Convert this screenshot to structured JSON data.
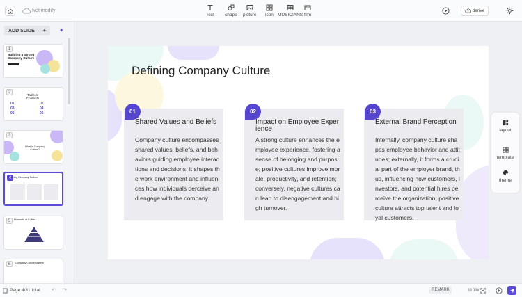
{
  "topbar": {
    "status": "Not modify",
    "tools": [
      {
        "label": "Text",
        "icon": "text-icon"
      },
      {
        "label": "shape",
        "icon": "shape-icon"
      },
      {
        "label": "picture",
        "icon": "picture-icon"
      },
      {
        "label": "icon",
        "icon": "icon-grid-icon"
      },
      {
        "label": "MUSICIANS",
        "icon": "table-icon"
      },
      {
        "label": "film",
        "icon": "film-icon"
      }
    ],
    "derive_label": "derive"
  },
  "sidebar": {
    "add_slide_label": "ADD SLIDE",
    "thumbnails": [
      {
        "num": "1",
        "title": "Building a Strong Company Culture"
      },
      {
        "num": "2",
        "title": "Table of Contents"
      },
      {
        "num": "3",
        "title": "What is Company Culture?"
      },
      {
        "num": "4",
        "title": "Defining Company Culture"
      },
      {
        "num": "5",
        "title": "Elements of Culture"
      },
      {
        "num": "6",
        "title": "Company Culture Matters"
      }
    ]
  },
  "slide": {
    "title": "Defining Company Culture",
    "cards": [
      {
        "num": "01",
        "title": "Shared Values and Beliefs",
        "body": "Company culture encompasses shared values, beliefs, and behaviors guiding employee interactions and decisions; it shapes the work environment and influences how individuals perceive and engage with the company."
      },
      {
        "num": "02",
        "title": "Impact on Employee Experience",
        "body": "A strong culture enhances the employee experience, fostering a sense of belonging and purpose; positive cultures improve morale, productivity, and retention; conversely, negative cultures can lead to disengagement and high turnover."
      },
      {
        "num": "03",
        "title": "External Brand Perception",
        "body": "Internally, company culture shapes employee behavior and attitudes; externally, it forms a crucial part of the employer brand, thus, influencing how customers, investors, and potential hires perceive the organization; positive culture attracts top talent and loyal customers."
      }
    ]
  },
  "right_panel": [
    {
      "label": "layout",
      "icon": "layout-icon"
    },
    {
      "label": "template",
      "icon": "template-icon"
    },
    {
      "label": "theme",
      "icon": "theme-icon"
    }
  ],
  "statusbar": {
    "page_count": "Page 4/31 total",
    "remark_label": "REMARK",
    "zoom": "110%"
  },
  "colors": {
    "accent": "#5645cf",
    "card": "#ececf0"
  }
}
